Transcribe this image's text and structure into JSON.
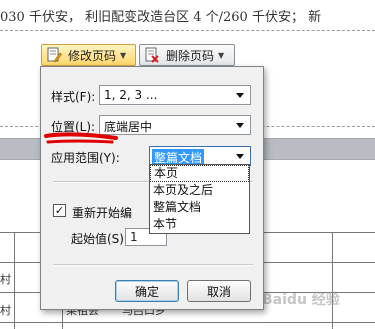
{
  "document": {
    "text_line": "030 千伏安，  利旧配变改造台区 4 个/260 千伏安；  新",
    "table_cells": [
      "村",
      "村",
      "菜祖会",
      "马吕口乡"
    ],
    "watermark": "Baidu 经验"
  },
  "toolbar": {
    "edit_label": "修改页码",
    "delete_label": "删除页码",
    "edit_icon": "edit-page-icon",
    "delete_icon": "delete-page-icon"
  },
  "dialog": {
    "style_label": "样式(F):",
    "style_value": "1, 2, 3 ...",
    "position_label": "位置(L):",
    "position_value": "底端居中",
    "scope_label": "应用范围(Y):",
    "scope_value": "整篇文档",
    "scope_options": [
      "本页",
      "本页及之后",
      "整篇文档",
      "本节"
    ],
    "restart_label": "重新开始编",
    "restart_checked": "✓",
    "start_label": "起始值(S):",
    "start_value": "1",
    "ok_label": "确定",
    "cancel_label": "取消"
  },
  "colors": {
    "highlight": "#3399ff",
    "annotation": "#e00000"
  }
}
